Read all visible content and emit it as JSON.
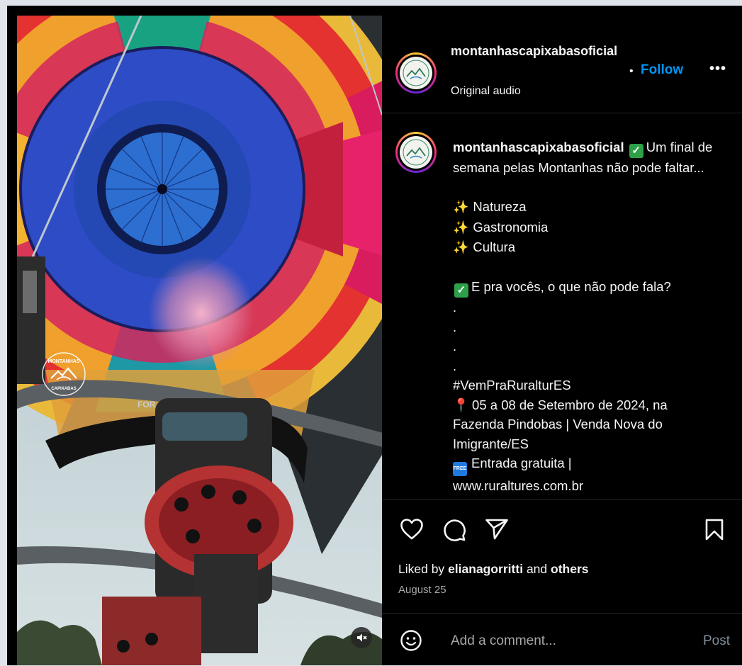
{
  "header": {
    "username": "montanhascapixabasoficial",
    "separator": "•",
    "follow_label": "Follow",
    "more_label": "•••",
    "audio_label": "Original audio"
  },
  "caption": {
    "username": "montanhascapixabasoficial",
    "intro": "Um final de semana pelas Montanhas não pode faltar...",
    "items": [
      "Natureza",
      "Gastronomia",
      "Cultura"
    ],
    "question": "E pra vocês, o que não pode fala?",
    "dots": [
      ".",
      ".",
      ".",
      "."
    ],
    "hashtag": "#VemPraRuralturES",
    "event_line": "05 a 08 de Setembro de 2024, na Fazenda Pindobas | Venda Nova do Imigrante/ES",
    "free_badge": "FREE",
    "entry_line": "Entrada gratuita |",
    "website": "www.ruraltures.com.br"
  },
  "engagement": {
    "liked_prefix": "Liked by",
    "liked_user": "elianagorritti",
    "liked_conj": "and",
    "liked_others": "others",
    "date": "August 25"
  },
  "comment": {
    "placeholder": "Add a comment...",
    "post_label": "Post"
  },
  "media": {
    "watermark_top": "MONTANHAS",
    "watermark_bottom": "CAPIXABAS",
    "burner_text": "FOR"
  },
  "icons": {
    "like": "heart-icon",
    "comment": "comment-bubble-icon",
    "share": "paper-plane-icon",
    "save": "bookmark-icon",
    "emoji": "smiley-icon",
    "mute": "speaker-muted-icon"
  },
  "colors": {
    "background": "#000000",
    "page_bg": "#dfe3ea",
    "follow": "#0095f6",
    "muted_text": "#a8a8a8",
    "check_emoji": "#2ea04a"
  }
}
